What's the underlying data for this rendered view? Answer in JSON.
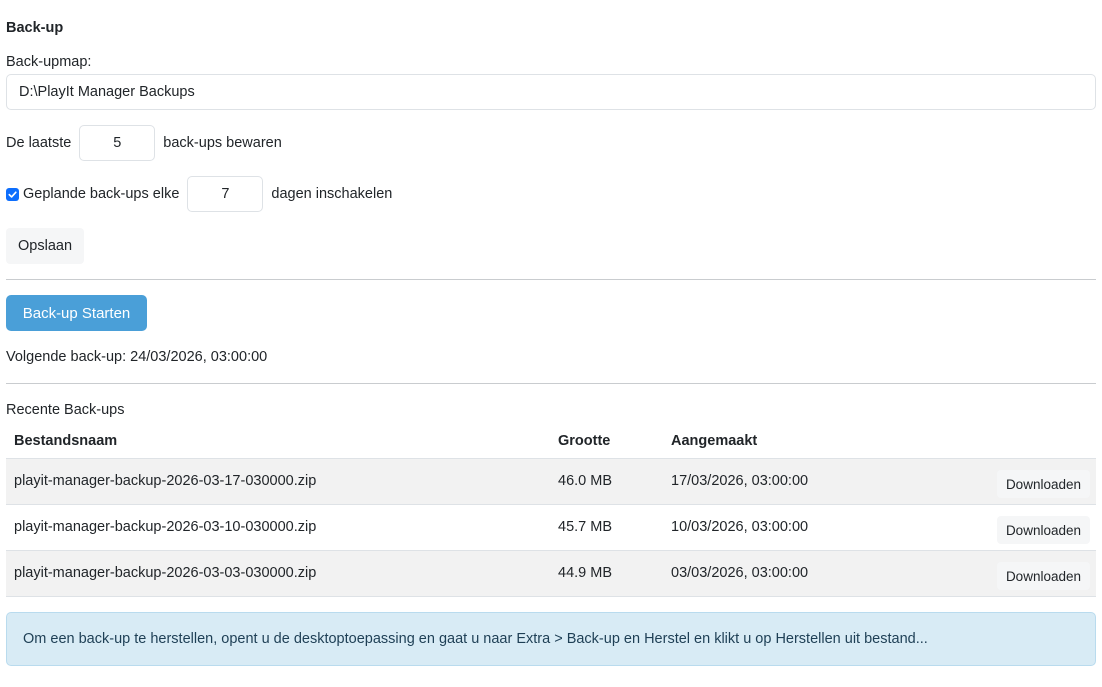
{
  "section_title": "Back-up",
  "folder": {
    "label": "Back-upmap:",
    "value": "D:\\PlayIt Manager Backups"
  },
  "keep": {
    "prefix": "De laatste",
    "value": "5",
    "suffix": "back-ups bewaren"
  },
  "schedule": {
    "checked": true,
    "prefix": "Geplande back-ups elke",
    "value": "7",
    "suffix": "dagen inschakelen"
  },
  "save_label": "Opslaan",
  "start_label": "Back-up Starten",
  "next_backup": "Volgende back-up: 24/03/2026, 03:00:00",
  "recent_title": "Recente Back-ups",
  "table": {
    "headers": [
      "Bestandsnaam",
      "Grootte",
      "Aangemaakt",
      ""
    ],
    "rows": [
      {
        "name": "playit-manager-backup-2026-03-17-030000.zip",
        "size": "46.0 MB",
        "created": "17/03/2026, 03:00:00",
        "action": "Downloaden"
      },
      {
        "name": "playit-manager-backup-2026-03-10-030000.zip",
        "size": "45.7 MB",
        "created": "10/03/2026, 03:00:00",
        "action": "Downloaden"
      },
      {
        "name": "playit-manager-backup-2026-03-03-030000.zip",
        "size": "44.9 MB",
        "created": "03/03/2026, 03:00:00",
        "action": "Downloaden"
      }
    ]
  },
  "info_text": "Om een back-up te herstellen, opent u de desktoptoepassing en gaat u naar Extra > Back-up en Herstel en klikt u op Herstellen uit bestand...",
  "colors": {
    "primary": "#4a9fd8",
    "checkbox": "#0d6efd",
    "alert_bg": "#d8ebf5"
  }
}
